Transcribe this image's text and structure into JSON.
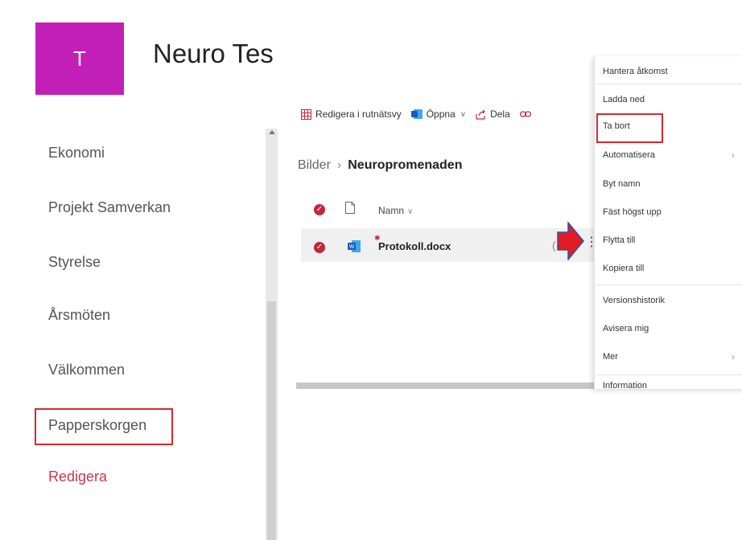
{
  "site": {
    "logo_letter": "T",
    "title": "Neuro Tes",
    "logo_color": "#c21fb7"
  },
  "nav": {
    "items": [
      "Ekonomi",
      "Projekt Samverkan",
      "Styrelse",
      "Årsmöten",
      "Välkommen",
      "Papperskorgen"
    ],
    "edit_label": "Redigera",
    "edit_color": "#c8364e"
  },
  "toolbar": {
    "edit_grid": "Redigera i rutnätsvy",
    "open": "Öppna",
    "share": "Dela"
  },
  "breadcrumb": {
    "parent": "Bilder",
    "current": "Neuropromenaden"
  },
  "list": {
    "column_name": "Namn",
    "file_name": "Protokoll.docx"
  },
  "context_menu": {
    "items": [
      "Hantera åtkomst",
      "Ladda ned",
      "Ta bort",
      "Automatisera",
      "Byt namn",
      "Fäst högst upp",
      "Flytta till",
      "Kopiera till",
      "Versionshistorik",
      "Avisera mig",
      "Mer",
      "Information"
    ]
  },
  "icons": [
    "grid-icon",
    "word-app-icon",
    "chevron-down-icon",
    "share-icon",
    "link-icon",
    "check-circle-icon",
    "file-icon",
    "word-file-icon",
    "more-icon",
    "chevron-right-icon",
    "red-arrow-icon"
  ],
  "colors": {
    "highlight": "#d7282f",
    "check": "#c4263d",
    "accent": "#0078d4"
  }
}
